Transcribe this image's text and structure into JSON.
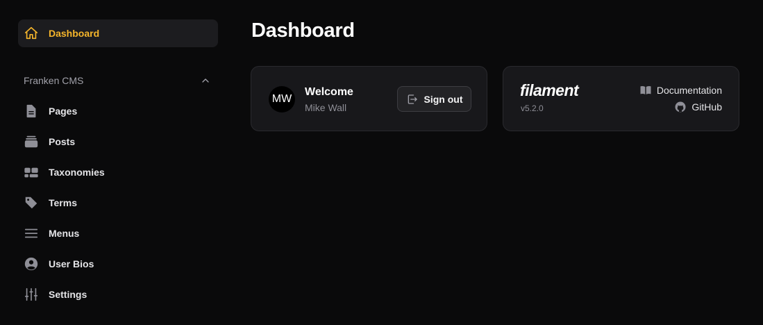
{
  "sidebar": {
    "active": {
      "label": "Dashboard",
      "icon": "home-icon",
      "color": "#f5b52b"
    },
    "group": {
      "label": "Franken CMS",
      "icon": "chevron-up-icon"
    },
    "items": [
      {
        "label": "Pages",
        "icon": "document-icon"
      },
      {
        "label": "Posts",
        "icon": "stack-icon"
      },
      {
        "label": "Taxonomies",
        "icon": "squares-icon"
      },
      {
        "label": "Terms",
        "icon": "tag-icon"
      },
      {
        "label": "Menus",
        "icon": "bars-icon"
      },
      {
        "label": "User Bios",
        "icon": "user-circle-icon"
      },
      {
        "label": "Settings",
        "icon": "sliders-icon"
      }
    ]
  },
  "main": {
    "title": "Dashboard",
    "welcome": {
      "avatar_initials": "MW",
      "title": "Welcome",
      "name": "Mike Wall",
      "signout_label": "Sign out"
    },
    "filament": {
      "brand": "filament",
      "version": "v5.2.0",
      "docs_label": "Documentation",
      "github_label": "GitHub"
    }
  }
}
